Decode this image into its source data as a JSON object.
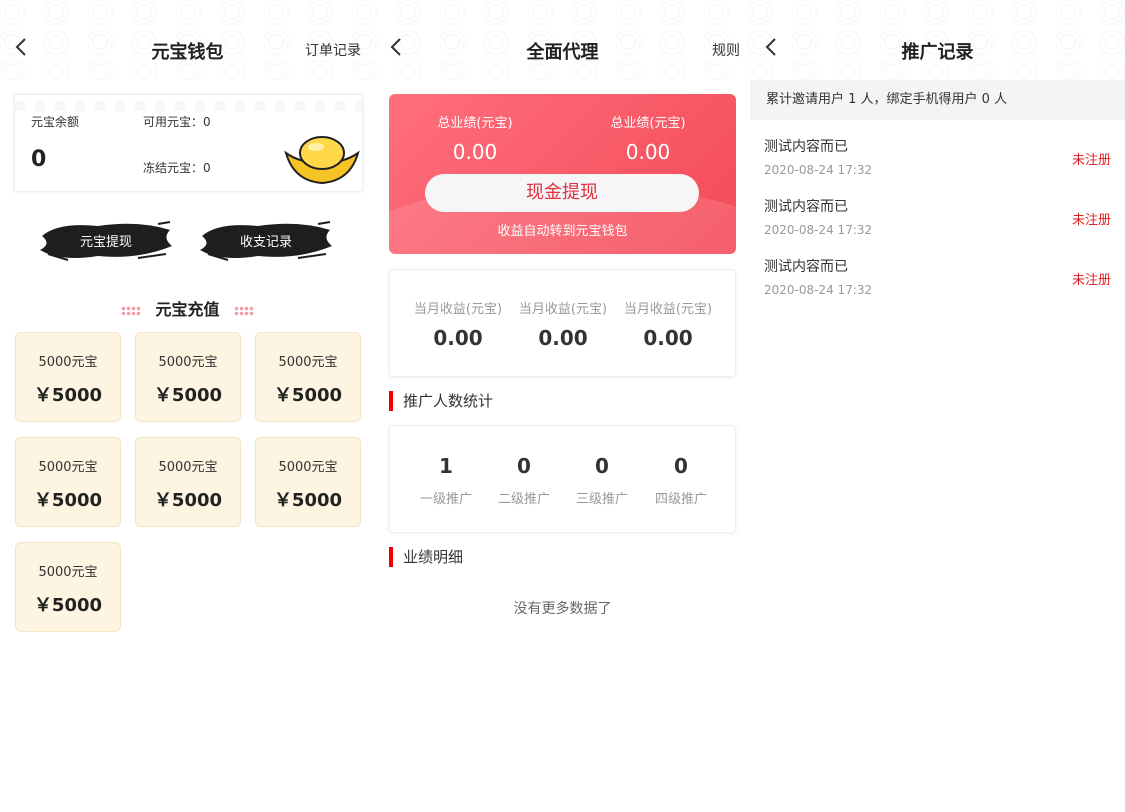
{
  "wallet": {
    "title": "元宝钱包",
    "right_link": "订单记录",
    "balance_label": "元宝余额",
    "balance_value": "0",
    "available_label": "可用元宝：0",
    "frozen_label": "冻结元宝：0",
    "withdraw_button": "元宝提现",
    "records_button": "收支记录",
    "recharge_title": "元宝充值",
    "packages": [
      {
        "amount": "5000元宝",
        "price": "￥5000"
      },
      {
        "amount": "5000元宝",
        "price": "￥5000"
      },
      {
        "amount": "5000元宝",
        "price": "￥5000"
      },
      {
        "amount": "5000元宝",
        "price": "￥5000"
      },
      {
        "amount": "5000元宝",
        "price": "￥5000"
      },
      {
        "amount": "5000元宝",
        "price": "￥5000"
      },
      {
        "amount": "5000元宝",
        "price": "￥5000"
      }
    ]
  },
  "agent": {
    "title": "全面代理",
    "right_link": "规则",
    "perf_left_label": "总业绩(元宝)",
    "perf_left_value": "0.00",
    "perf_right_label": "总业绩(元宝)",
    "perf_right_value": "0.00",
    "cash_button": "现金提现",
    "note": "收益自动转到元宝钱包",
    "monthly": [
      {
        "label": "当月收益(元宝)",
        "value": "0.00"
      },
      {
        "label": "当月收益(元宝)",
        "value": "0.00"
      },
      {
        "label": "当月收益(元宝)",
        "value": "0.00"
      }
    ],
    "promo_title": "推广人数统计",
    "levels": [
      {
        "value": "1",
        "label": "一级推广"
      },
      {
        "value": "0",
        "label": "二级推广"
      },
      {
        "value": "0",
        "label": "三级推广"
      },
      {
        "value": "0",
        "label": "四级推广"
      }
    ],
    "detail_title": "业绩明细",
    "empty_text": "没有更多数据了"
  },
  "promo_records": {
    "title": "推广记录",
    "summary": "累计邀请用户 1 人，绑定手机得用户 0 人",
    "records": [
      {
        "title": "测试内容而已",
        "date": "2020-08-24 17:32",
        "status": "未注册"
      },
      {
        "title": "测试内容而已",
        "date": "2020-08-24 17:32",
        "status": "未注册"
      },
      {
        "title": "测试内容而已",
        "date": "2020-08-24 17:32",
        "status": "未注册"
      }
    ]
  },
  "colors": {
    "accent_red": "#f34a57",
    "status_red": "#e02020",
    "package_bg": "#fdf4e2"
  }
}
